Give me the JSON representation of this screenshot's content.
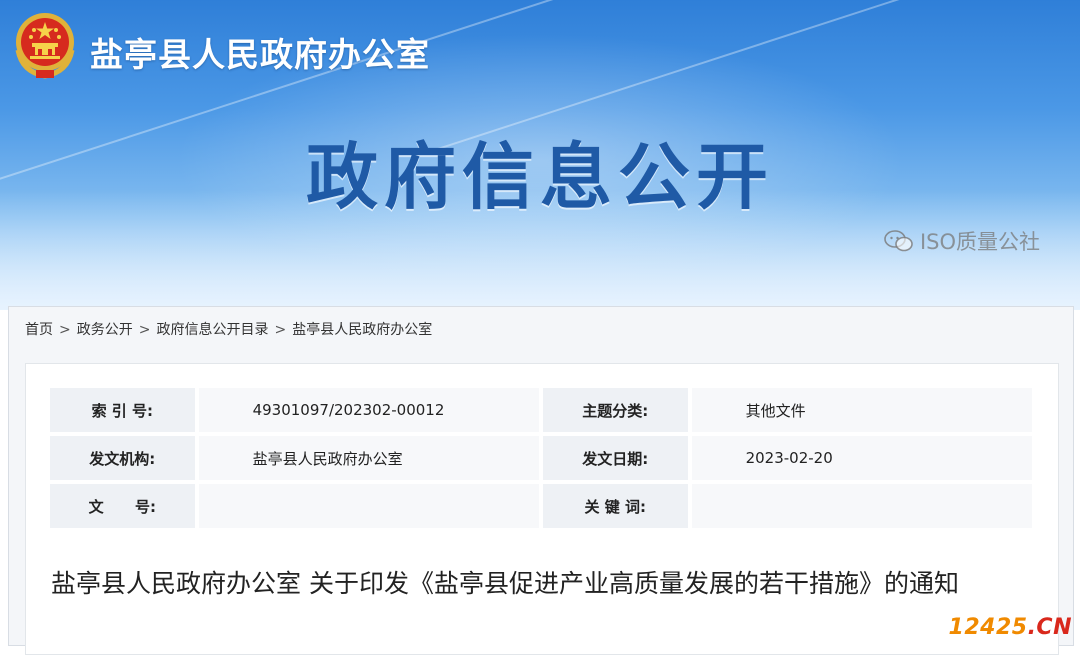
{
  "header": {
    "site_title": "盐亭县人民政府办公室",
    "banner_title": "政府信息公开"
  },
  "breadcrumb": {
    "items": [
      "首页",
      "政务公开",
      "政府信息公开目录",
      "盐亭县人民政府办公室"
    ],
    "separator": ">"
  },
  "info": {
    "index_label": "索 引 号:",
    "index_value": "49301097/202302-00012",
    "category_label": "主题分类:",
    "category_value": "其他文件",
    "issuer_label": "发文机构:",
    "issuer_value": "盐亭县人民政府办公室",
    "date_label": "发文日期:",
    "date_value": "2023-02-20",
    "docno_label": "文      号:",
    "docno_value": "",
    "keywords_label": "关 键 词:",
    "keywords_value": ""
  },
  "document": {
    "title": "盐亭县人民政府办公室 关于印发《盐亭县促进产业高质量发展的若干措施》的通知"
  },
  "watermarks": {
    "wechat": "ISO质量公社",
    "site_main": "12425",
    "site_suffix": ".CN"
  },
  "colors": {
    "banner_top": "#2f7fd8",
    "title_blue": "#1f5aa6",
    "site_orange": "#f08a00",
    "site_red": "#d9281c"
  },
  "icons": {
    "emblem": "national-emblem-icon",
    "wechat": "wechat-bubble-icon"
  }
}
